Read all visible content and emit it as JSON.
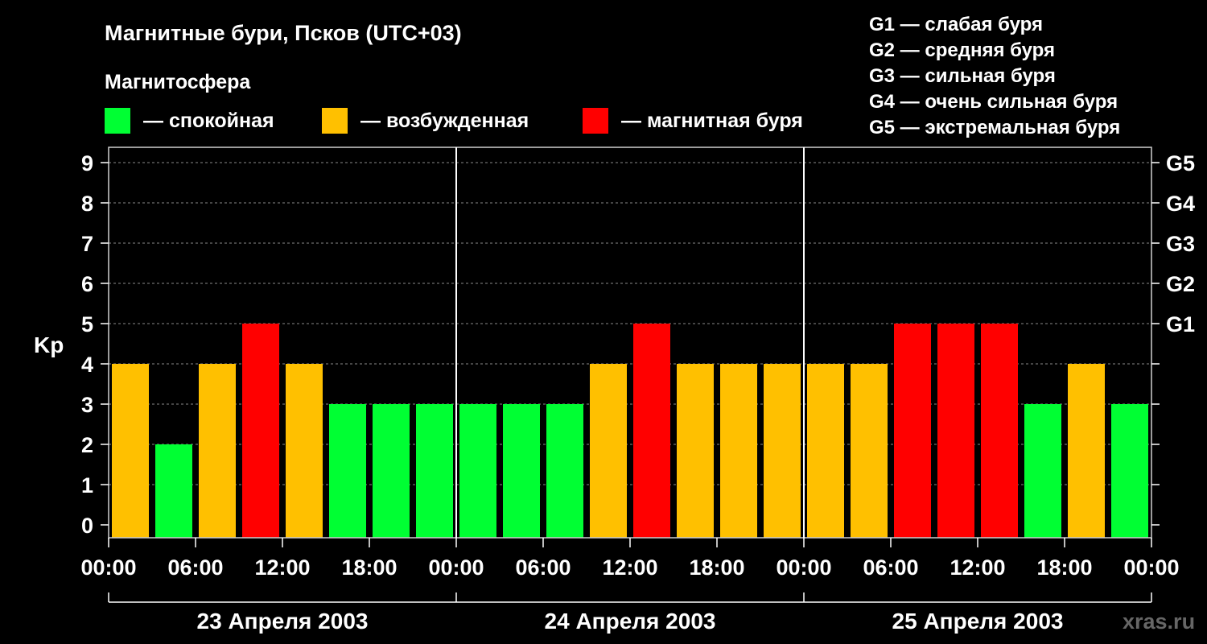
{
  "chart_data": {
    "type": "bar",
    "title": "Магнитные бури, Псков (UTC+03)",
    "legend_title": "Магнитосфера",
    "legend": [
      {
        "label": "— спокойная",
        "color": "#00ff33"
      },
      {
        "label": "— возбужденная",
        "color": "#ffc000"
      },
      {
        "label": "— магнитная буря",
        "color": "#ff0000"
      }
    ],
    "g_scale": [
      "G1 — слабая буря",
      "G2 — средняя буря",
      "G3 — сильная буря",
      "G4 — очень сильная буря",
      "G5 — экстремальная буря"
    ],
    "ylabel": "Kp",
    "ylim": [
      0,
      9
    ],
    "y_ticks": [
      "0",
      "1",
      "2",
      "3",
      "4",
      "5",
      "6",
      "7",
      "8",
      "9"
    ],
    "right_ticks": [
      {
        "kp": 5,
        "label": "G1"
      },
      {
        "kp": 6,
        "label": "G2"
      },
      {
        "kp": 7,
        "label": "G3"
      },
      {
        "kp": 8,
        "label": "G4"
      },
      {
        "kp": 9,
        "label": "G5"
      }
    ],
    "x_tick_labels": [
      "00:00",
      "06:00",
      "12:00",
      "18:00",
      "00:00",
      "06:00",
      "12:00",
      "18:00",
      "00:00",
      "06:00",
      "12:00",
      "18:00",
      "00:00"
    ],
    "days": [
      "23 Апреля 2003",
      "24 Апреля 2003",
      "25 Апреля 2003"
    ],
    "colors": {
      "quiet": "#00ff33",
      "active": "#ffc000",
      "storm": "#ff0000"
    },
    "values": [
      4,
      2,
      4,
      5,
      4,
      3,
      3,
      3,
      3,
      3,
      3,
      4,
      5,
      4,
      4,
      4,
      4,
      4,
      5,
      5,
      5,
      3,
      4,
      3
    ],
    "grid": true
  },
  "watermark": "xras.ru"
}
